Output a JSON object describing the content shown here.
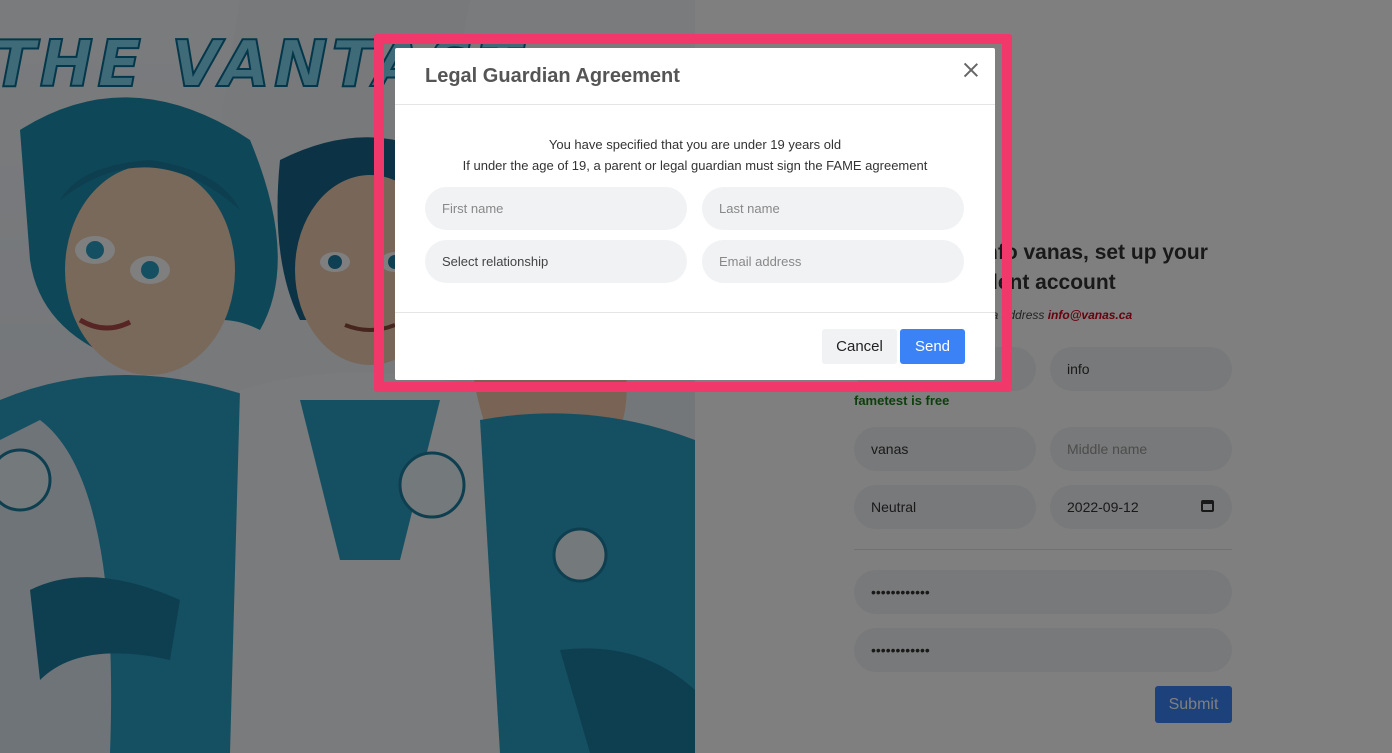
{
  "hero": {
    "title": "THE VANTAST"
  },
  "signup": {
    "heading_line1": "nfo vanas, set up your",
    "heading_line2": "dent account",
    "subnote_prefix": "na  address ",
    "subnote_email": "info@vanas.ca",
    "username_value": "info",
    "availability": "fametest is free",
    "first_name_value": "vanas",
    "middle_name_placeholder": "Middle name",
    "gender_value": "Neutral",
    "birth_date_value": "2022-09-12",
    "password_mask": "••••••••••••",
    "confirm_password_mask": "••••••••••••",
    "submit_label": "Submit"
  },
  "modal": {
    "title": "Legal Guardian Agreement",
    "message_line1": "You have specified that you are under 19 years old",
    "message_line2": "If under the age of 19, a parent or legal guardian must sign the FAME agreement",
    "first_name_placeholder": "First name",
    "last_name_placeholder": "Last name",
    "relationship_placeholder": "Select relationship",
    "email_placeholder": "Email address",
    "cancel_label": "Cancel",
    "send_label": "Send"
  },
  "colors": {
    "highlight": "#f0386b",
    "primary_button": "#3b82f6",
    "email_accent": "#d0021b",
    "available_text": "#1a7f1a"
  }
}
